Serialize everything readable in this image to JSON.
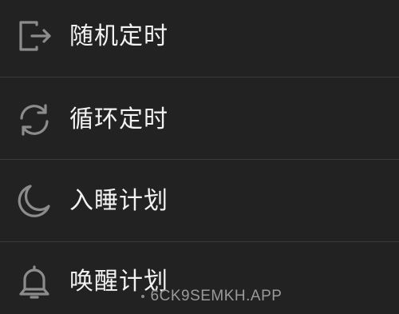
{
  "menu": {
    "items": [
      {
        "label": "随机定时",
        "icon": "exit-door-icon"
      },
      {
        "label": "循环定时",
        "icon": "refresh-cycle-icon"
      },
      {
        "label": "入睡计划",
        "icon": "moon-icon"
      },
      {
        "label": "唤醒计划",
        "icon": "bell-icon"
      }
    ]
  },
  "watermark": {
    "text": "6CK9SEMKH.APP"
  },
  "colors": {
    "background": "#222222",
    "text": "#f2f2f2",
    "icon": "#8c8c8c",
    "divider": "#3a3a3a"
  }
}
